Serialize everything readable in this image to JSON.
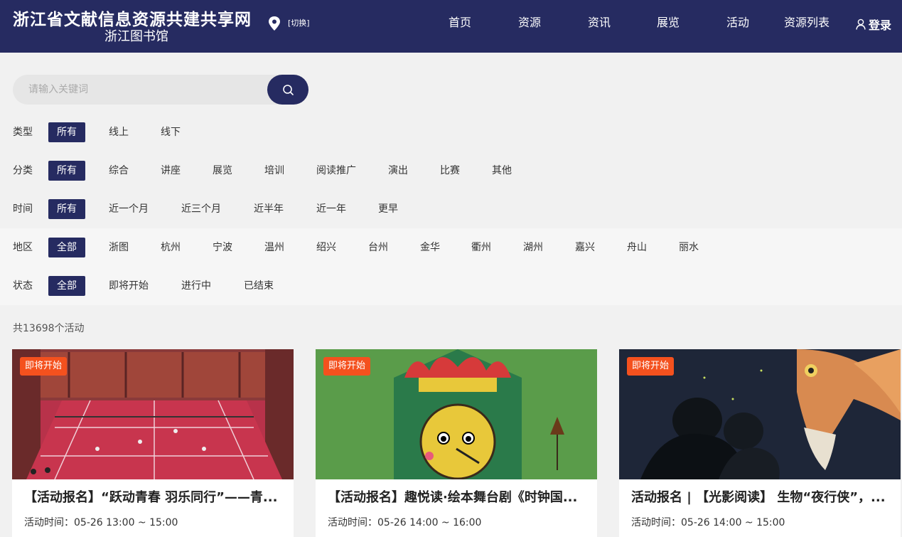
{
  "header": {
    "brand_main": "浙江省文献信息资源共建共享网",
    "brand_sub": "浙江图书馆",
    "location_switch": "[切换]",
    "nav": [
      "首页",
      "资源",
      "资讯",
      "展览",
      "活动",
      "资源列表"
    ],
    "login": "登录"
  },
  "search": {
    "placeholder": "请输入关键词"
  },
  "filters": {
    "type": {
      "label": "类型",
      "options": [
        "所有",
        "线上",
        "线下"
      ]
    },
    "category": {
      "label": "分类",
      "options": [
        "所有",
        "综合",
        "讲座",
        "展览",
        "培训",
        "阅读推广",
        "演出",
        "比赛",
        "其他"
      ]
    },
    "time": {
      "label": "时间",
      "options": [
        "所有",
        "近一个月",
        "近三个月",
        "近半年",
        "近一年",
        "更早"
      ]
    },
    "region": {
      "label": "地区",
      "options": [
        "全部",
        "浙图",
        "杭州",
        "宁波",
        "温州",
        "绍兴",
        "台州",
        "金华",
        "衢州",
        "湖州",
        "嘉兴",
        "舟山",
        "丽水"
      ]
    },
    "status": {
      "label": "状态",
      "options": [
        "全部",
        "即将开始",
        "进行中",
        "已结束"
      ]
    }
  },
  "count_text": "共13698个活动",
  "cards": [
    {
      "badge": "即将开始",
      "title": "【活动报名】“跃动青春 羽乐同行”——青...",
      "time": "活动时间：05-26 13:00 ~ 15:00",
      "image_icon": "badminton-court-photo"
    },
    {
      "badge": "即将开始",
      "title": "【活动报名】趣悦读·绘本舞台剧《时钟国...",
      "time": "活动时间：05-26 14:00 ~ 16:00",
      "image_icon": "clock-puppet-photo"
    },
    {
      "badge": "即将开始",
      "title": "活动报名 | 【光影阅读】 生物“夜行侠”，...",
      "time": "活动时间：05-26 14:00 ~ 15:00",
      "image_icon": "owl-projection-photo"
    }
  ],
  "colors": {
    "primary": "#262b61",
    "badge": "#f4511e",
    "background": "#f1f1f1"
  }
}
